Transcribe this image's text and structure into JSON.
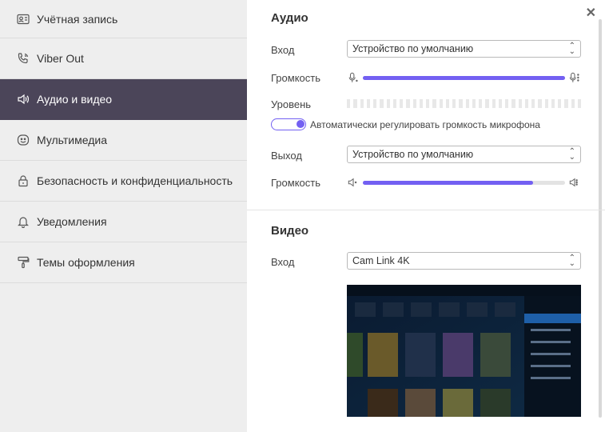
{
  "sidebar": {
    "items": [
      {
        "label": "Учётная запись",
        "icon": "account-card-icon",
        "active": false
      },
      {
        "label": "Viber Out",
        "icon": "phone-icon",
        "active": false
      },
      {
        "label": "Аудио и видео",
        "icon": "speaker-icon",
        "active": true
      },
      {
        "label": "Мультимедиа",
        "icon": "smiley-icon",
        "active": false
      },
      {
        "label": "Безопасность и конфиденциальность",
        "icon": "lock-icon",
        "active": false
      },
      {
        "label": "Уведомления",
        "icon": "bell-icon",
        "active": false
      },
      {
        "label": "Темы оформления",
        "icon": "paint-roller-icon",
        "active": false
      }
    ]
  },
  "audio": {
    "title": "Аудио",
    "input_label": "Вход",
    "input_value": "Устройство по умолчанию",
    "input_volume_label": "Громкость",
    "input_volume_percent": 100,
    "level_label": "Уровень",
    "auto_adjust_label": "Автоматически регулировать громкость микрофона",
    "auto_adjust_on": true,
    "output_label": "Выход",
    "output_value": "Устройство по умолчанию",
    "output_volume_label": "Громкость",
    "output_volume_percent": 84
  },
  "video": {
    "title": "Видео",
    "input_label": "Вход",
    "input_value": "Cam Link 4K"
  },
  "colors": {
    "accent": "#7360f2",
    "sidebar_bg": "#eeeeee",
    "sidebar_active_bg": "#4b4559"
  }
}
